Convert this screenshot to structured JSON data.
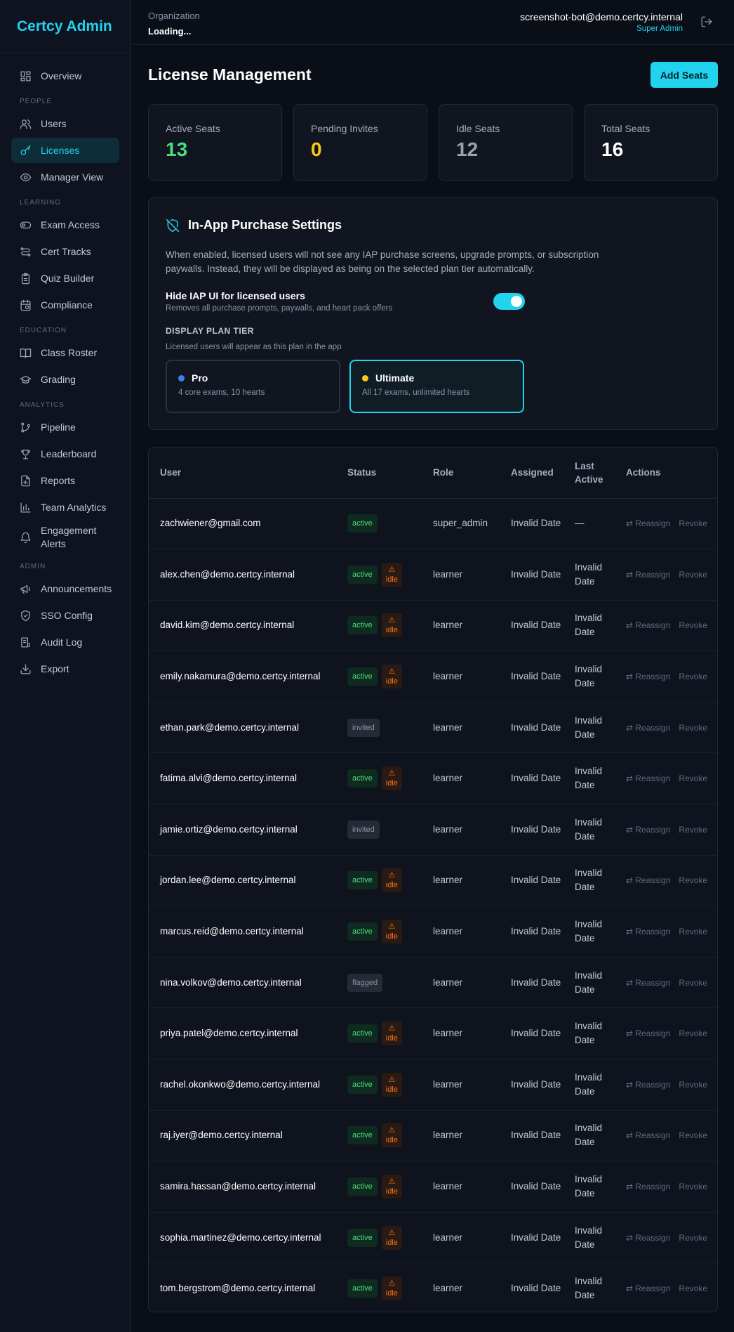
{
  "brand": "Certcy Admin",
  "sidebar": {
    "items": [
      {
        "label": "Overview",
        "icon": "grid-icon"
      },
      {
        "section": "PEOPLE"
      },
      {
        "label": "Users",
        "icon": "users-icon"
      },
      {
        "label": "Licenses",
        "icon": "key-icon",
        "active": true
      },
      {
        "label": "Manager View",
        "icon": "eye-icon"
      },
      {
        "section": "LEARNING"
      },
      {
        "label": "Exam Access",
        "icon": "toggle-icon"
      },
      {
        "label": "Cert Tracks",
        "icon": "track-icon"
      },
      {
        "label": "Quiz Builder",
        "icon": "clipboard-icon"
      },
      {
        "label": "Compliance",
        "icon": "calendar-clock-icon"
      },
      {
        "section": "EDUCATION"
      },
      {
        "label": "Class Roster",
        "icon": "book-icon"
      },
      {
        "label": "Grading",
        "icon": "graduation-cap-icon"
      },
      {
        "section": "ANALYTICS"
      },
      {
        "label": "Pipeline",
        "icon": "pipeline-icon"
      },
      {
        "label": "Leaderboard",
        "icon": "trophy-icon"
      },
      {
        "label": "Reports",
        "icon": "file-chart-icon"
      },
      {
        "label": "Team Analytics",
        "icon": "bar-chart-icon"
      },
      {
        "label": "Engagement Alerts",
        "icon": "bell-icon"
      },
      {
        "section": "ADMIN"
      },
      {
        "label": "Announcements",
        "icon": "megaphone-icon"
      },
      {
        "label": "SSO Config",
        "icon": "shield-icon"
      },
      {
        "label": "Audit Log",
        "icon": "log-icon"
      },
      {
        "label": "Export",
        "icon": "download-icon"
      }
    ]
  },
  "header": {
    "org_label": "Organization",
    "org_value": "Loading...",
    "user_email": "screenshot-bot@demo.certcy.internal",
    "user_role": "Super Admin"
  },
  "page": {
    "title": "License Management",
    "add_seats": "Add Seats"
  },
  "stats": [
    {
      "label": "Active Seats",
      "value": "13",
      "color": "#4ade80"
    },
    {
      "label": "Pending Invites",
      "value": "0",
      "color": "#facc15"
    },
    {
      "label": "Idle Seats",
      "value": "12",
      "color": "#9ca3af"
    },
    {
      "label": "Total Seats",
      "value": "16",
      "color": "#ffffff"
    }
  ],
  "iap": {
    "title": "In-App Purchase Settings",
    "description": "When enabled, licensed users will not see any IAP purchase screens, upgrade prompts, or subscription paywalls. Instead, they will be displayed as being on the selected plan tier automatically.",
    "hide_label": "Hide IAP UI for licensed users",
    "hide_sub": "Removes all purchase prompts, paywalls, and heart pack offers",
    "toggle_on": true,
    "tier_label": "DISPLAY PLAN TIER",
    "tier_sub": "Licensed users will appear as this plan in the app",
    "tiers": [
      {
        "name": "Pro",
        "desc": "4 core exams, 10 hearts",
        "dot": "#3b82f6"
      },
      {
        "name": "Ultimate",
        "desc": "All 17 exams, unlimited hearts",
        "dot": "#facc15",
        "selected": true
      }
    ]
  },
  "table": {
    "columns": [
      "User",
      "Status",
      "Role",
      "Assigned",
      "Last Active",
      "Actions"
    ],
    "reassign_label": "⇄ Reassign",
    "revoke_label": "Revoke",
    "idle_label": "idle",
    "rows": [
      {
        "user": "zachwiener@gmail.com",
        "status": "active",
        "idle": false,
        "role": "super_admin",
        "assigned": "Invalid Date",
        "last_active": "—"
      },
      {
        "user": "alex.chen@demo.certcy.internal",
        "status": "active",
        "idle": true,
        "role": "learner",
        "assigned": "Invalid Date",
        "last_active": "Invalid Date"
      },
      {
        "user": "david.kim@demo.certcy.internal",
        "status": "active",
        "idle": true,
        "role": "learner",
        "assigned": "Invalid Date",
        "last_active": "Invalid Date"
      },
      {
        "user": "emily.nakamura@demo.certcy.internal",
        "status": "active",
        "idle": true,
        "role": "learner",
        "assigned": "Invalid Date",
        "last_active": "Invalid Date"
      },
      {
        "user": "ethan.park@demo.certcy.internal",
        "status": "invited",
        "idle": false,
        "role": "learner",
        "assigned": "Invalid Date",
        "last_active": "Invalid Date"
      },
      {
        "user": "fatima.alvi@demo.certcy.internal",
        "status": "active",
        "idle": true,
        "role": "learner",
        "assigned": "Invalid Date",
        "last_active": "Invalid Date"
      },
      {
        "user": "jamie.ortiz@demo.certcy.internal",
        "status": "invited",
        "idle": false,
        "role": "learner",
        "assigned": "Invalid Date",
        "last_active": "Invalid Date"
      },
      {
        "user": "jordan.lee@demo.certcy.internal",
        "status": "active",
        "idle": true,
        "role": "learner",
        "assigned": "Invalid Date",
        "last_active": "Invalid Date"
      },
      {
        "user": "marcus.reid@demo.certcy.internal",
        "status": "active",
        "idle": true,
        "role": "learner",
        "assigned": "Invalid Date",
        "last_active": "Invalid Date"
      },
      {
        "user": "nina.volkov@demo.certcy.internal",
        "status": "flagged",
        "idle": false,
        "role": "learner",
        "assigned": "Invalid Date",
        "last_active": "Invalid Date"
      },
      {
        "user": "priya.patel@demo.certcy.internal",
        "status": "active",
        "idle": true,
        "role": "learner",
        "assigned": "Invalid Date",
        "last_active": "Invalid Date"
      },
      {
        "user": "rachel.okonkwo@demo.certcy.internal",
        "status": "active",
        "idle": true,
        "role": "learner",
        "assigned": "Invalid Date",
        "last_active": "Invalid Date"
      },
      {
        "user": "raj.iyer@demo.certcy.internal",
        "status": "active",
        "idle": true,
        "role": "learner",
        "assigned": "Invalid Date",
        "last_active": "Invalid Date"
      },
      {
        "user": "samira.hassan@demo.certcy.internal",
        "status": "active",
        "idle": true,
        "role": "learner",
        "assigned": "Invalid Date",
        "last_active": "Invalid Date"
      },
      {
        "user": "sophia.martinez@demo.certcy.internal",
        "status": "active",
        "idle": true,
        "role": "learner",
        "assigned": "Invalid Date",
        "last_active": "Invalid Date"
      },
      {
        "user": "tom.bergstrom@demo.certcy.internal",
        "status": "active",
        "idle": true,
        "role": "learner",
        "assigned": "Invalid Date",
        "last_active": "Invalid Date"
      }
    ]
  }
}
